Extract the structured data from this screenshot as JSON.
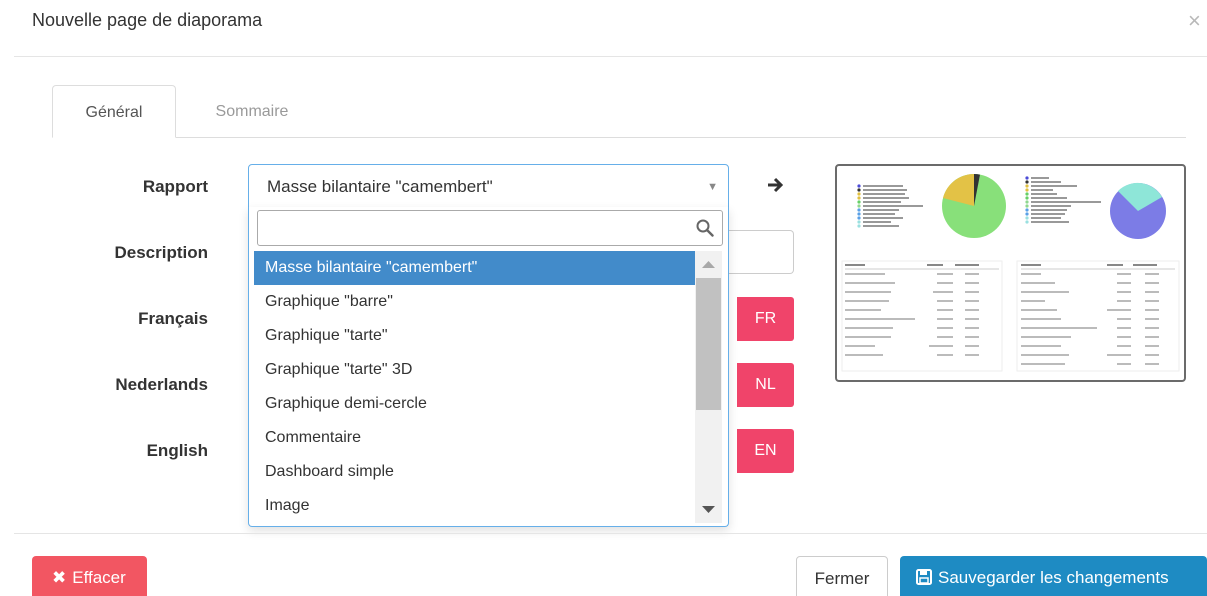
{
  "modal": {
    "title": "Nouvelle page de diaporama",
    "close_symbol": "×"
  },
  "tabs": [
    {
      "label": "Général",
      "active": true
    },
    {
      "label": "Sommaire",
      "active": false
    }
  ],
  "form": {
    "rapport_label": "Rapport",
    "description_label": "Description",
    "francais_label": "Français",
    "nederlands_label": "Nederlands",
    "english_label": "English",
    "rapport_value": "Masse bilantaire \"camembert\"",
    "search_value": "",
    "options": [
      "Masse bilantaire \"camembert\"",
      "Graphique \"barre\"",
      "Graphique \"tarte\"",
      "Graphique \"tarte\" 3D",
      "Graphique demi-cercle",
      "Commentaire",
      "Dashboard simple",
      "Image"
    ],
    "selected_index": 0,
    "lang_buttons": {
      "fr": "FR",
      "nl": "NL",
      "en": "EN"
    }
  },
  "footer": {
    "effacer_label": "Effacer",
    "fermer_label": "Fermer",
    "save_label": "Sauvegarder les changements"
  },
  "icons": {
    "close": "close-icon",
    "search": "search-icon",
    "arrow": "arrow-right-icon",
    "effacer": "times-icon",
    "save": "floppy-disk-icon"
  },
  "colors": {
    "accent_blue": "#428bca",
    "focus_border": "#66afe9",
    "lang_pink": "#f0446a",
    "danger": "#f25662",
    "primary": "#1e8bc3"
  }
}
